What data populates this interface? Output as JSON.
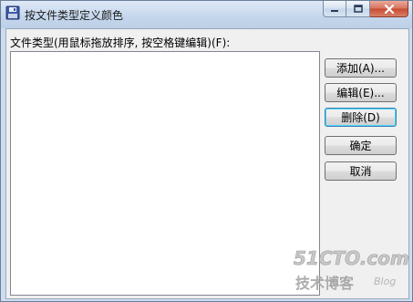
{
  "window": {
    "title": "按文件类型定义颜色",
    "controls": {
      "minimize_icon": "minimize-icon",
      "maximize_icon": "maximize-icon",
      "close_icon": "close-icon"
    }
  },
  "list": {
    "label": "文件类型(用鼠标拖放排序, 按空格键编辑)(F):",
    "items": []
  },
  "buttons": {
    "add": "添加(A)...",
    "edit": "编辑(E)...",
    "delete": "删除(D)",
    "ok": "确定",
    "cancel": "取消"
  },
  "watermark": {
    "brand": "51CTO.com",
    "sub": "技术博客",
    "blog": "Blog"
  },
  "colors": {
    "default_button_border": "#3c7fb1",
    "close_button": "#c74a2f"
  }
}
